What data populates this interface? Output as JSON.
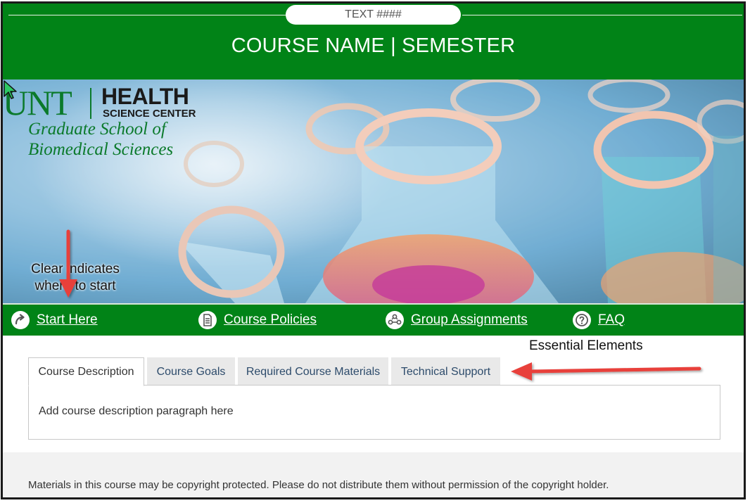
{
  "header": {
    "pill_text": "TEXT ####",
    "course_title": "COURSE NAME | SEMESTER"
  },
  "banner": {
    "logo": {
      "unt": "UNT",
      "health": "HEALTH",
      "science_center": "SCIENCE CENTER",
      "graduate_line1": "Graduate School of",
      "graduate_line2": "Biomedical Sciences"
    },
    "annotation": "Clear indicates where to start"
  },
  "nav": {
    "items": [
      {
        "label": "Start Here",
        "icon": "arrow-curve-icon"
      },
      {
        "label": "Course Policies",
        "icon": "document-icon"
      },
      {
        "label": "Group Assignments",
        "icon": "group-icon"
      },
      {
        "label": "FAQ",
        "icon": "question-icon"
      }
    ]
  },
  "content": {
    "annotation": "Essential Elements",
    "tabs": [
      {
        "label": "Course Description",
        "active": true
      },
      {
        "label": "Course Goals",
        "active": false
      },
      {
        "label": "Required Course Materials",
        "active": false
      },
      {
        "label": "Technical Support",
        "active": false
      }
    ],
    "panel_text": "Add course description paragraph here"
  },
  "footer": {
    "text": "Materials in this course may be copyright protected. Please do not distribute them without permission of the copyright holder."
  },
  "colors": {
    "brand_green": "#018317",
    "annotation_arrow": "#e8403a",
    "tab_text": "#2d4b6b"
  }
}
